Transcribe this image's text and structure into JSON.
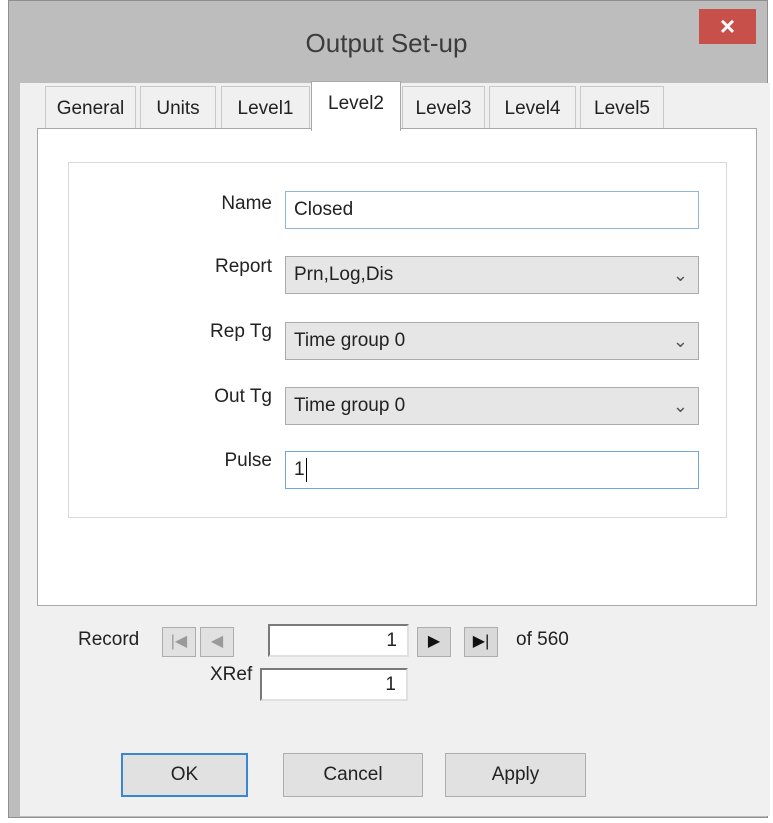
{
  "window": {
    "title": "Output Set-up",
    "close_glyph": "×"
  },
  "tabs": [
    {
      "label": "General",
      "active": false
    },
    {
      "label": "Units",
      "active": false
    },
    {
      "label": "Level1",
      "active": false
    },
    {
      "label": "Level2",
      "active": true
    },
    {
      "label": "Level3",
      "active": false
    },
    {
      "label": "Level4",
      "active": false
    },
    {
      "label": "Level5",
      "active": false
    }
  ],
  "form": {
    "name": {
      "label": "Name",
      "value": "Closed"
    },
    "report": {
      "label": "Report",
      "value": "Prn,Log,Dis"
    },
    "rep_tg": {
      "label": "Rep Tg",
      "value": "Time group 0"
    },
    "out_tg": {
      "label": "Out Tg",
      "value": "Time group 0"
    },
    "pulse": {
      "label": "Pulse",
      "value": "1"
    }
  },
  "record_nav": {
    "label": "Record",
    "current": "1",
    "of_text": "of 560",
    "first_icon": "first-record-icon",
    "prev_icon": "prev-record-icon",
    "next_icon": "next-record-icon",
    "last_icon": "last-record-icon"
  },
  "xref": {
    "label": "XRef",
    "value": "1"
  },
  "buttons": {
    "ok": "OK",
    "cancel": "Cancel",
    "apply": "Apply"
  },
  "colors": {
    "close_button": "#c7514a",
    "focus_border": "#6fa8dc",
    "default_button_border": "#3a86d4"
  }
}
